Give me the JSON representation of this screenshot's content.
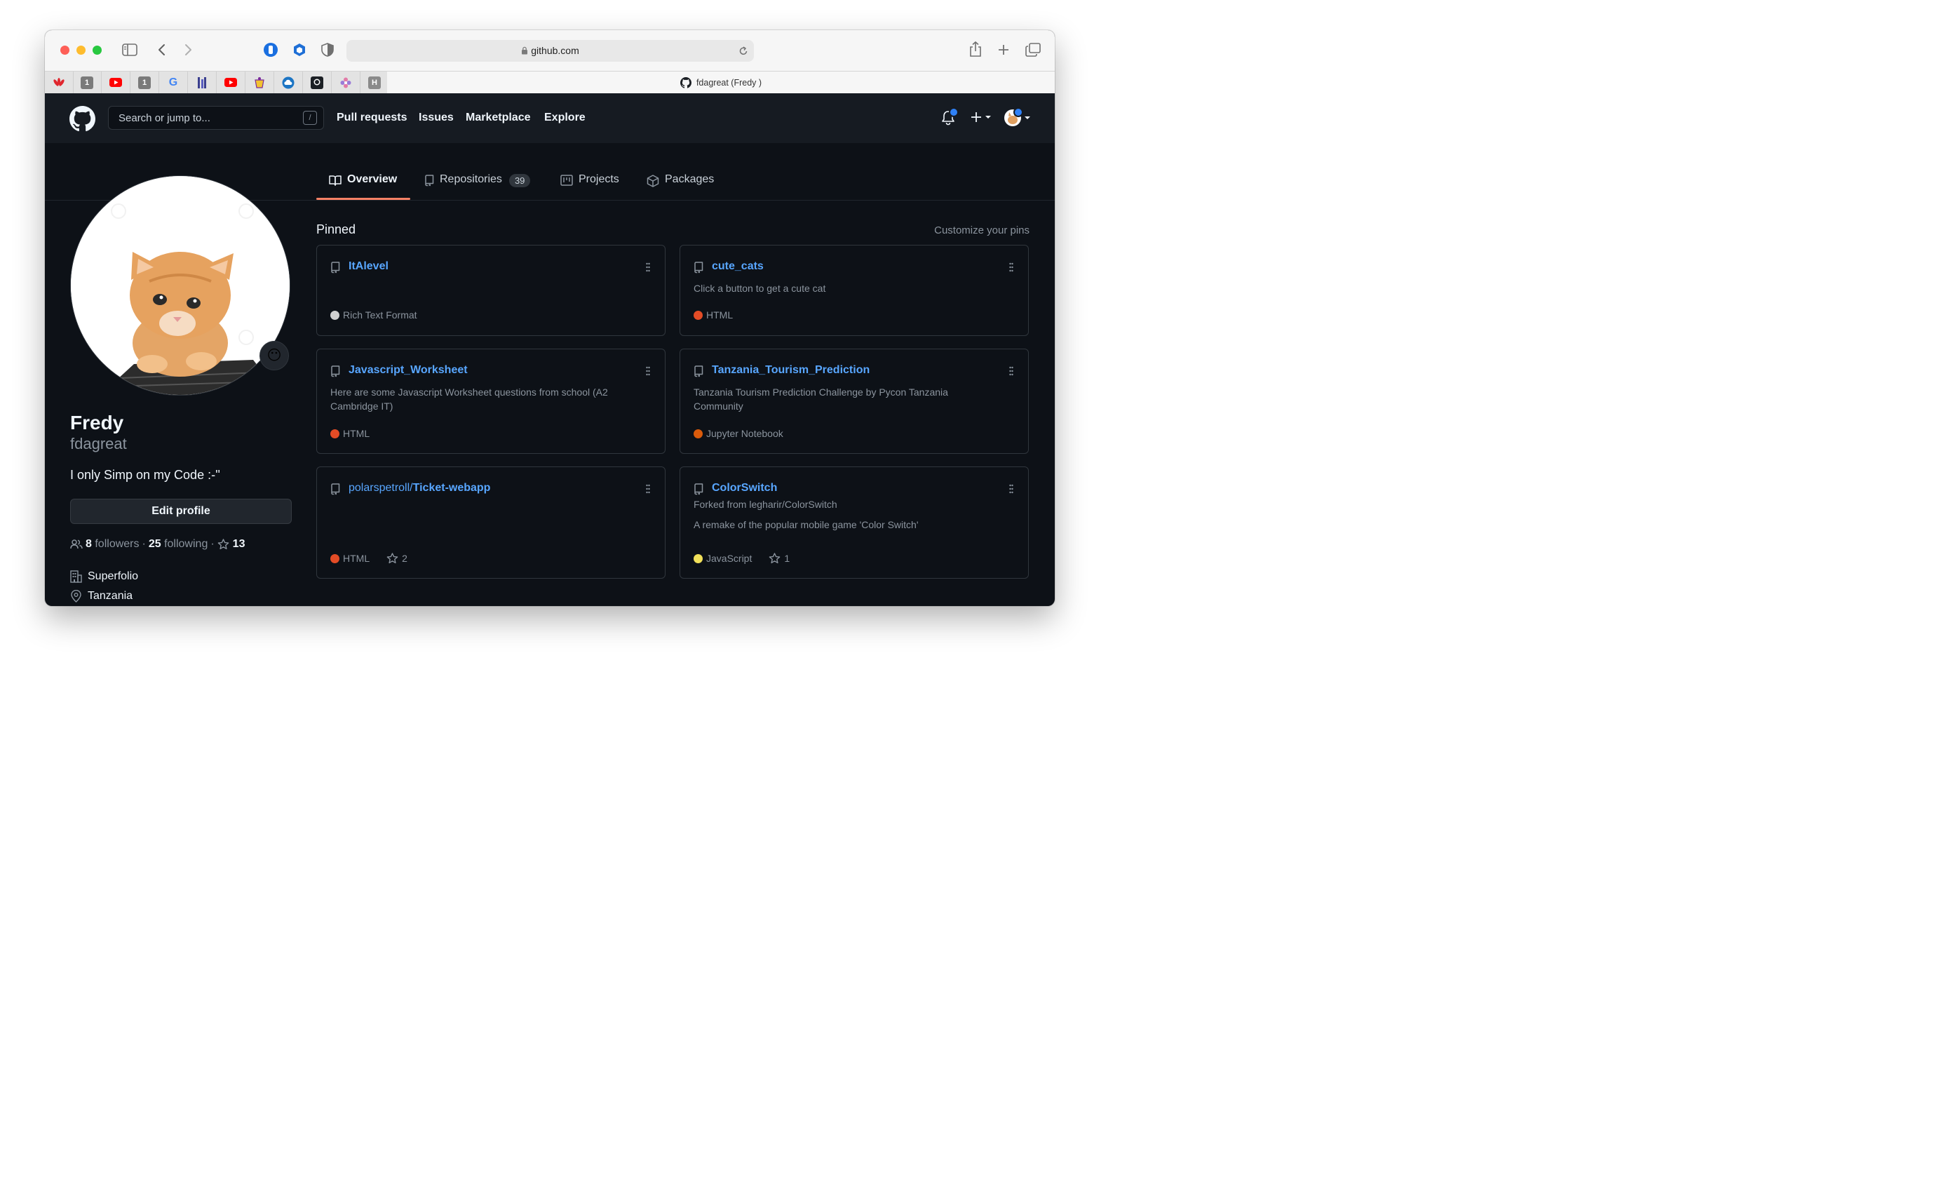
{
  "browser": {
    "url": "github.com",
    "active_tab_title": "fdagreat (Fredy )",
    "pinned_tabs": [
      {
        "icon": "huawei-icon",
        "label": ""
      },
      {
        "icon": "onepassword-icon",
        "label": "1"
      },
      {
        "icon": "youtube-icon",
        "label": ""
      },
      {
        "icon": "onepassword-icon",
        "label": "1"
      },
      {
        "icon": "google-icon",
        "label": "G"
      },
      {
        "icon": "app-icon",
        "label": ""
      },
      {
        "icon": "youtube-icon",
        "label": ""
      },
      {
        "icon": "cup-icon",
        "label": ""
      },
      {
        "icon": "cloud-icon",
        "label": ""
      },
      {
        "icon": "github-icon",
        "label": ""
      },
      {
        "icon": "flower-icon",
        "label": ""
      },
      {
        "icon": "letter-h-icon",
        "label": "H"
      }
    ]
  },
  "header": {
    "search_placeholder": "Search or jump to...",
    "search_shortcut": "/",
    "nav": [
      "Pull requests",
      "Issues",
      "Marketplace",
      "Explore"
    ]
  },
  "tabs": {
    "overview": "Overview",
    "repositories": "Repositories",
    "repositories_count": "39",
    "projects": "Projects",
    "packages": "Packages"
  },
  "profile": {
    "display_name": "Fredy",
    "username": "fdagreat",
    "bio": "I only Simp on my Code :-''",
    "edit_profile": "Edit profile",
    "followers_count": "8",
    "followers_label": "followers",
    "separator": "·",
    "following_count": "25",
    "following_label": "following",
    "stars_count": "13",
    "company": "Superfolio",
    "location": "Tanzania",
    "status_emoji": "😶"
  },
  "pinned": {
    "title": "Pinned",
    "customize": "Customize your pins",
    "cards": [
      {
        "name": "ItAlevel",
        "owner": "",
        "forked_from": "",
        "description": "",
        "language": "Rich Text Format",
        "language_color": "#d0d0d0",
        "stars": ""
      },
      {
        "name": "cute_cats",
        "owner": "",
        "forked_from": "",
        "description": "Click a button to get a cute cat",
        "language": "HTML",
        "language_color": "#e34c26",
        "stars": ""
      },
      {
        "name": "Javascript_Worksheet",
        "owner": "",
        "forked_from": "",
        "description": "Here are some Javascript Worksheet questions from school (A2 Cambridge IT)",
        "language": "HTML",
        "language_color": "#e34c26",
        "stars": ""
      },
      {
        "name": "Tanzania_Tourism_Prediction",
        "owner": "",
        "forked_from": "",
        "description": "Tanzania Tourism Prediction Challenge by Pycon Tanzania Community",
        "language": "Jupyter Notebook",
        "language_color": "#da5b0b",
        "stars": ""
      },
      {
        "name": "Ticket-webapp",
        "owner": "polarspetroll/",
        "forked_from": "",
        "description": "",
        "language": "HTML",
        "language_color": "#e34c26",
        "stars": "2"
      },
      {
        "name": "ColorSwitch",
        "owner": "",
        "forked_from": "Forked from legharir/ColorSwitch",
        "description": "A remake of the popular mobile game 'Color Switch'",
        "language": "JavaScript",
        "language_color": "#f1e05a",
        "stars": "1"
      }
    ]
  }
}
